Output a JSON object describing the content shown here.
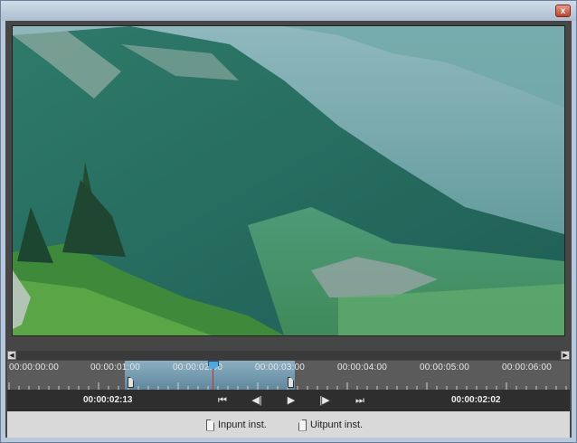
{
  "window": {
    "close_glyph": "x"
  },
  "timeline": {
    "ruler_labels": [
      "00:00:00:00",
      "00:00:01:00",
      "00:00:02:00",
      "00:00:03:00",
      "00:00:04:00",
      "00:00:05:00",
      "00:00:06:00"
    ]
  },
  "controls": {
    "current_time": "00:00:02:13",
    "duration": "00:00:02:02",
    "buttons": {
      "go_to_in": "⏮",
      "step_back": "◀|",
      "play": "▶",
      "step_forward": "|▶",
      "go_to_out": "⏭"
    }
  },
  "bottombar": {
    "set_in": "Inpunt inst.",
    "set_out": "Uitpunt inst."
  },
  "colors": {
    "range_highlight": "#7ea6bb",
    "playhead": "#4da7e0",
    "playhead_line": "#d52a2a"
  }
}
